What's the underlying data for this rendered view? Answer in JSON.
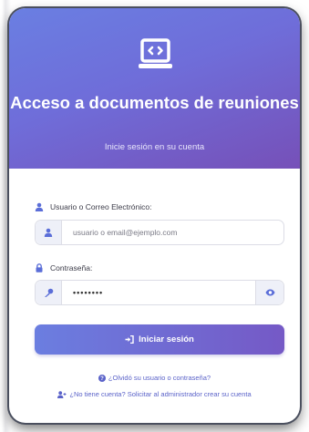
{
  "header": {
    "title": "Acceso a documentos de reuniones",
    "subtitle": "Inicie sesión en su cuenta"
  },
  "form": {
    "username_label": "Usuario o Correo Electrónico:",
    "username_placeholder": "usuario o email@ejemplo.com",
    "password_label": "Contraseña:",
    "password_value": "••••••••",
    "submit_label": "Iniciar sesión"
  },
  "links": {
    "forgot": "¿Olvidó su usuario o contraseña?",
    "no_account": "¿No tiene cuenta? Solicitar al administrador crear su cuenta"
  },
  "colors": {
    "accent": "#6b7ee0",
    "accent_dark": "#7559c6"
  },
  "icons": {
    "logo": "laptop-code-icon",
    "user": "user-icon",
    "lock": "lock-icon",
    "key": "key-icon",
    "eye": "eye-icon",
    "sign_in": "sign-in-icon",
    "question": "question-circle-icon",
    "user_plus": "user-plus-icon"
  }
}
